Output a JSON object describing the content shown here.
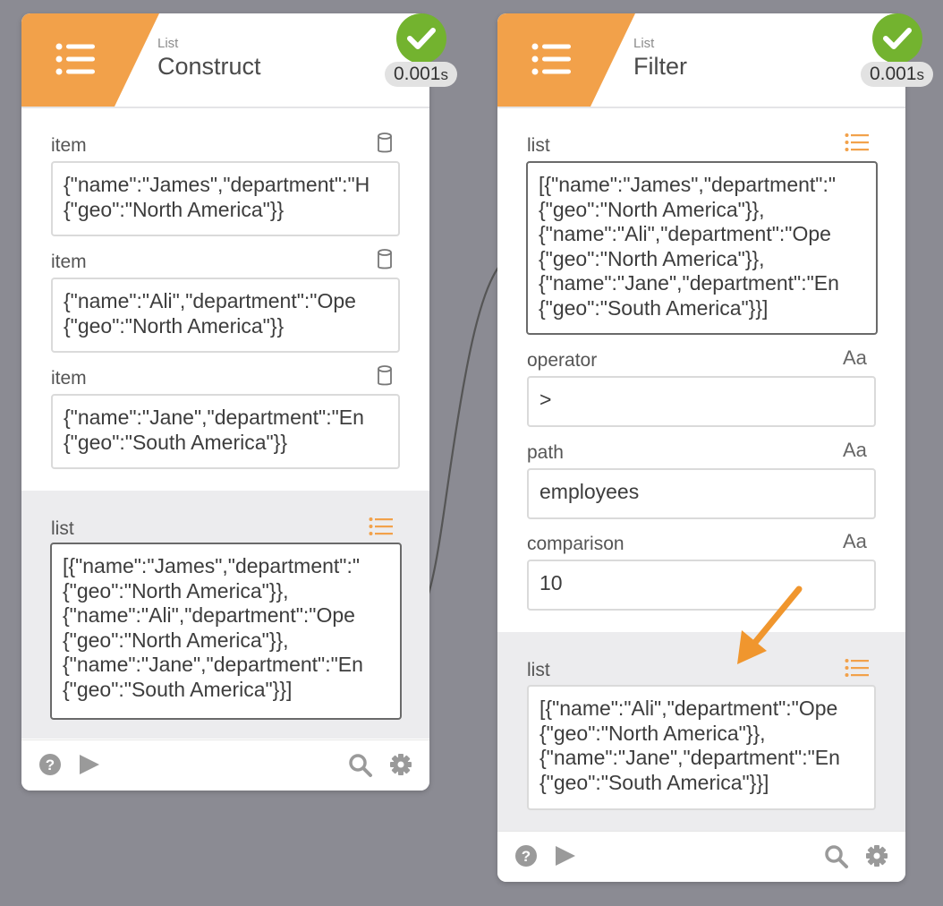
{
  "colors": {
    "accent": "#f2a14a",
    "success": "#73b32f",
    "canvas": "#8b8b93"
  },
  "construct": {
    "kind": "List",
    "title": "Construct",
    "timing_value": "0.001",
    "timing_unit": "s",
    "inputs": [
      {
        "label": "item",
        "value": "{\"name\":\"James\",\"department\":\"H\n{\"geo\":\"North America\"}}",
        "icon": "database-icon"
      },
      {
        "label": "item",
        "value": "{\"name\":\"Ali\",\"department\":\"Ope\n{\"geo\":\"North America\"}}",
        "icon": "database-icon"
      },
      {
        "label": "item",
        "value": "{\"name\":\"Jane\",\"department\":\"En\n{\"geo\":\"South America\"}}",
        "icon": "database-icon"
      }
    ],
    "output": {
      "label": "list",
      "value": "[{\"name\":\"James\",\"department\":\"\n{\"geo\":\"North America\"}},\n{\"name\":\"Ali\",\"department\":\"Ope\n{\"geo\":\"North America\"}},\n{\"name\":\"Jane\",\"department\":\"En\n{\"geo\":\"South America\"}}]",
      "icon": "list-icon"
    }
  },
  "filter": {
    "kind": "List",
    "title": "Filter",
    "timing_value": "0.001",
    "timing_unit": "s",
    "inputs": [
      {
        "label": "list",
        "value": "[{\"name\":\"James\",\"department\":\"\n{\"geo\":\"North America\"}},\n{\"name\":\"Ali\",\"department\":\"Ope\n{\"geo\":\"North America\"}},\n{\"name\":\"Jane\",\"department\":\"En\n{\"geo\":\"South America\"}}]",
        "icon": "list-icon"
      },
      {
        "label": "operator",
        "value": ">",
        "icon": "Aa"
      },
      {
        "label": "path",
        "value": "employees",
        "icon": "Aa"
      },
      {
        "label": "comparison",
        "value": "10",
        "icon": "Aa"
      }
    ],
    "output": {
      "label": "list",
      "value": "[{\"name\":\"Ali\",\"department\":\"Ope\n{\"geo\":\"North America\"}},\n{\"name\":\"Jane\",\"department\":\"En\n{\"geo\":\"South America\"}}]",
      "icon": "list-icon"
    }
  },
  "footer_icons": [
    "help-icon",
    "play-icon",
    "search-icon",
    "gear-icon"
  ]
}
